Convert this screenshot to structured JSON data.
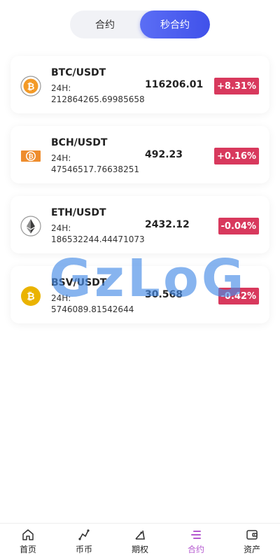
{
  "tabs": [
    {
      "label": "合约",
      "active": false
    },
    {
      "label": "秒合约",
      "active": true
    }
  ],
  "markets": [
    {
      "pair": "BTC/USDT",
      "vol_label": "24H:",
      "vol": "212864265.69985658",
      "price": "116206.01",
      "change": "+8.31%",
      "icon": "btc-icon"
    },
    {
      "pair": "BCH/USDT",
      "vol_label": "24H:",
      "vol": "47546517.76638251",
      "price": "492.23",
      "change": "+0.16%",
      "icon": "bch-icon"
    },
    {
      "pair": "ETH/USDT",
      "vol_label": "24H:",
      "vol": "186532244.44471073",
      "price": "2432.12",
      "change": "-0.04%",
      "icon": "eth-icon"
    },
    {
      "pair": "BSV/USDT",
      "vol_label": "24H:",
      "vol": "5746089.81542644",
      "price": "30.568",
      "change": "-0.42%",
      "icon": "bsv-icon"
    }
  ],
  "watermark": "GzLoG",
  "nav": [
    {
      "label": "首页",
      "icon": "home-icon"
    },
    {
      "label": "币币",
      "icon": "coin-trade-icon"
    },
    {
      "label": "期权",
      "icon": "options-icon"
    },
    {
      "label": "合约",
      "icon": "contract-icon",
      "active": true
    },
    {
      "label": "资产",
      "icon": "wallet-icon"
    }
  ],
  "colors": {
    "accent": "#4a5cef",
    "change_badge": "#d8395d",
    "nav_active": "#b55ad0"
  }
}
